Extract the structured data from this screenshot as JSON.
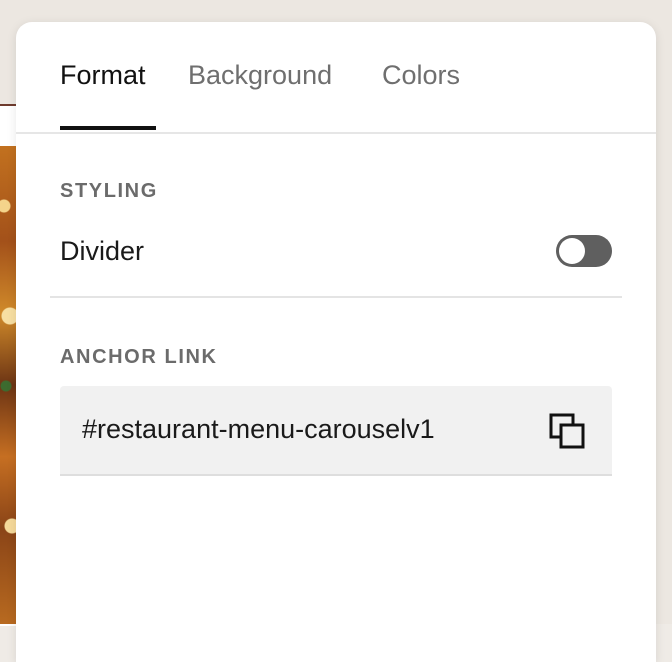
{
  "tabs": [
    {
      "label": "Format",
      "active": true
    },
    {
      "label": "Background",
      "active": false
    },
    {
      "label": "Colors",
      "active": false
    }
  ],
  "styling": {
    "heading": "STYLING",
    "divider_label": "Divider",
    "divider_enabled": false
  },
  "anchor_link": {
    "heading": "ANCHOR LINK",
    "value": "#restaurant-menu-carouselv1",
    "action_icon": "copy-icon"
  },
  "colors": {
    "active_text": "#111111",
    "inactive_text": "#6f6f6f",
    "toggle_off": "#5f5f5f",
    "field_bg": "#f1f1f1"
  }
}
